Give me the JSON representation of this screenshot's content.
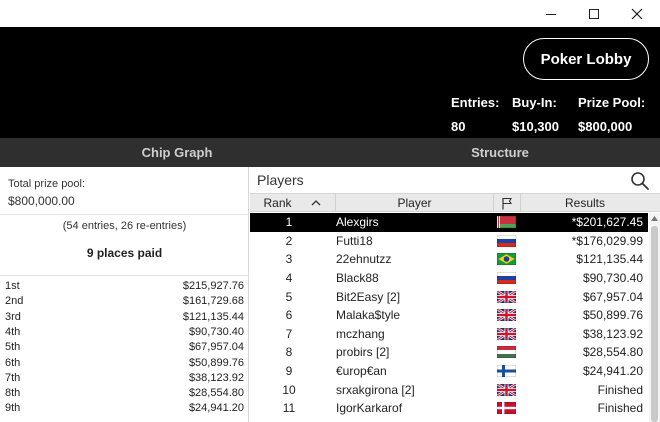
{
  "window": {
    "minimize_icon": "minimize-icon",
    "maximize_icon": "maximize-icon",
    "close_icon": "close-icon"
  },
  "header": {
    "lobby_button": "Poker Lobby",
    "entries_label": "Entries:",
    "entries_value": "80",
    "buyin_label": "Buy-In:",
    "buyin_value": "$10,300",
    "prizepool_label": "Prize Pool:",
    "prizepool_value": "$800,000"
  },
  "tabs": [
    {
      "label": "Chip Graph"
    },
    {
      "label": "Structure"
    }
  ],
  "left": {
    "prize_label": "Total prize pool:",
    "prize_value": "$800,000.00",
    "entries_note": "(54 entries, 26 re-entries)",
    "places_paid": "9 places paid",
    "payouts": [
      {
        "place": "1st",
        "amount": "$215,927.76"
      },
      {
        "place": "2nd",
        "amount": "$161,729.68"
      },
      {
        "place": "3rd",
        "amount": "$121,135.44"
      },
      {
        "place": "4th",
        "amount": "$90,730.40"
      },
      {
        "place": "5th",
        "amount": "$67,957.04"
      },
      {
        "place": "6th",
        "amount": "$50,899.76"
      },
      {
        "place": "7th",
        "amount": "$38,123.92"
      },
      {
        "place": "8th",
        "amount": "$28,554.80"
      },
      {
        "place": "9th",
        "amount": "$24,941.20"
      }
    ]
  },
  "players": {
    "title": "Players",
    "search_icon": "search-icon",
    "columns": {
      "rank": "Rank",
      "player": "Player",
      "results": "Results"
    },
    "rows": [
      {
        "rank": "1",
        "player": "Alexgirs",
        "flag": "belarus",
        "result": "*$201,627.45",
        "selected": true
      },
      {
        "rank": "2",
        "player": "Futti18",
        "flag": "russia",
        "result": "*$176,029.99"
      },
      {
        "rank": "3",
        "player": "22ehnutzz",
        "flag": "brazil",
        "result": "$121,135.44"
      },
      {
        "rank": "4",
        "player": "Black88",
        "flag": "russia",
        "result": "$90,730.40"
      },
      {
        "rank": "5",
        "player": "Bit2Easy [2]",
        "flag": "uk",
        "result": "$67,957.04"
      },
      {
        "rank": "6",
        "player": "Malaka$tyle",
        "flag": "uk",
        "result": "$50,899.76"
      },
      {
        "rank": "7",
        "player": "mczhang",
        "flag": "uk",
        "result": "$38,123.92"
      },
      {
        "rank": "8",
        "player": "probirs [2]",
        "flag": "hungary",
        "result": "$28,554.80"
      },
      {
        "rank": "9",
        "player": "€urop€an",
        "flag": "finland",
        "result": "$24,941.20"
      },
      {
        "rank": "10",
        "player": "srxakgirona [2]",
        "flag": "uk",
        "result": "Finished"
      },
      {
        "rank": "11",
        "player": "IgorKarkarof",
        "flag": "denmark",
        "result": "Finished"
      }
    ]
  }
}
